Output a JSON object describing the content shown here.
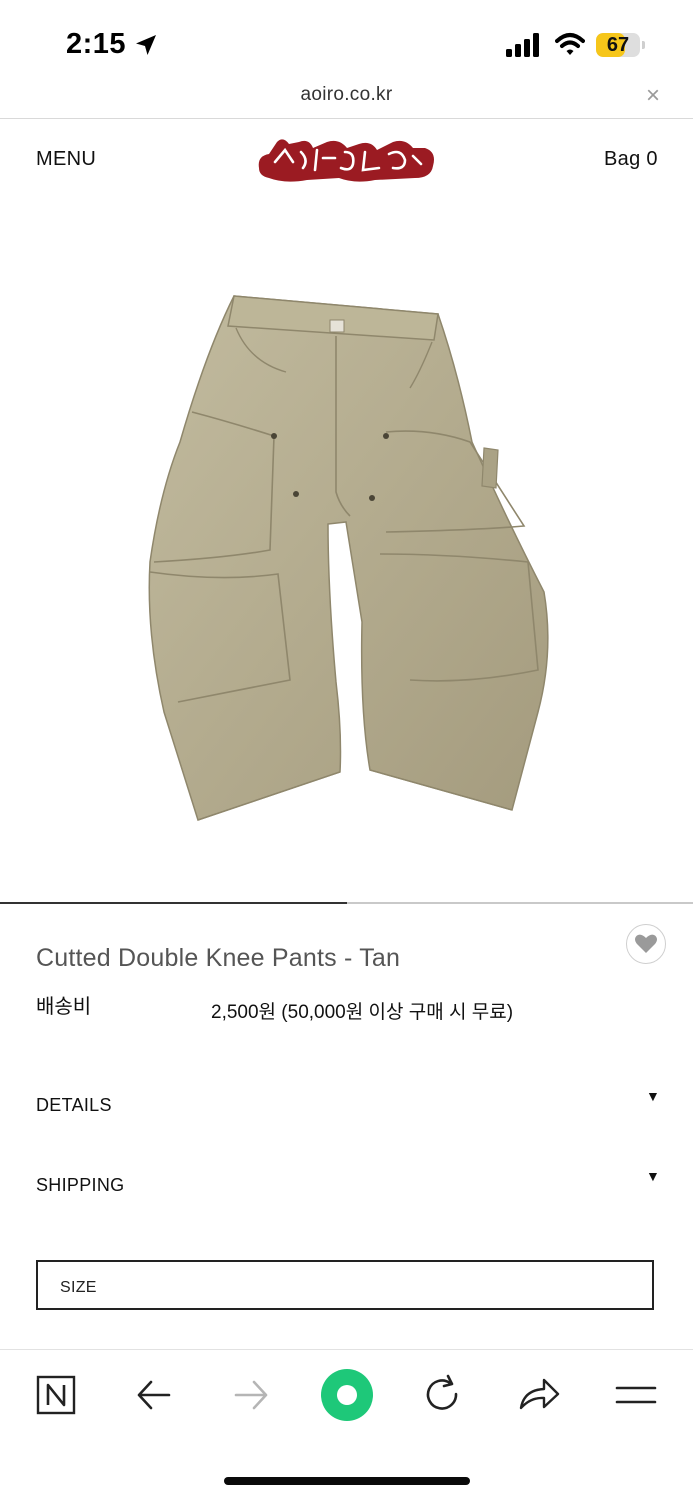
{
  "status_bar": {
    "time": "2:15",
    "battery": "67",
    "battery_level": 0.67
  },
  "url_bar": {
    "url": "aoiro.co.kr",
    "close_symbol": "×"
  },
  "header": {
    "menu_label": "MENU",
    "logo_text": "aoiro",
    "bag_label": "Bag 0",
    "logo_color": "#9b1b22"
  },
  "product": {
    "image_name": "tan-double-knee-pants",
    "title": "Cutted Double Knee Pants - Tan",
    "shipping_label": "배송비",
    "shipping_value": "2,500원 (50,000원 이상 구매 시 무료)",
    "pants_color": "#b5ad90"
  },
  "carousel": {
    "current": 1,
    "total": 2
  },
  "accordions": [
    {
      "label": "DETAILS"
    },
    {
      "label": "SHIPPING"
    }
  ],
  "size_select": {
    "label": "SIZE"
  },
  "browser_toolbar": {
    "items": [
      "naver-icon",
      "back-icon",
      "forward-icon",
      "home-icon",
      "reload-icon",
      "share-icon",
      "menu-icon"
    ],
    "accent": "#1ec879"
  }
}
